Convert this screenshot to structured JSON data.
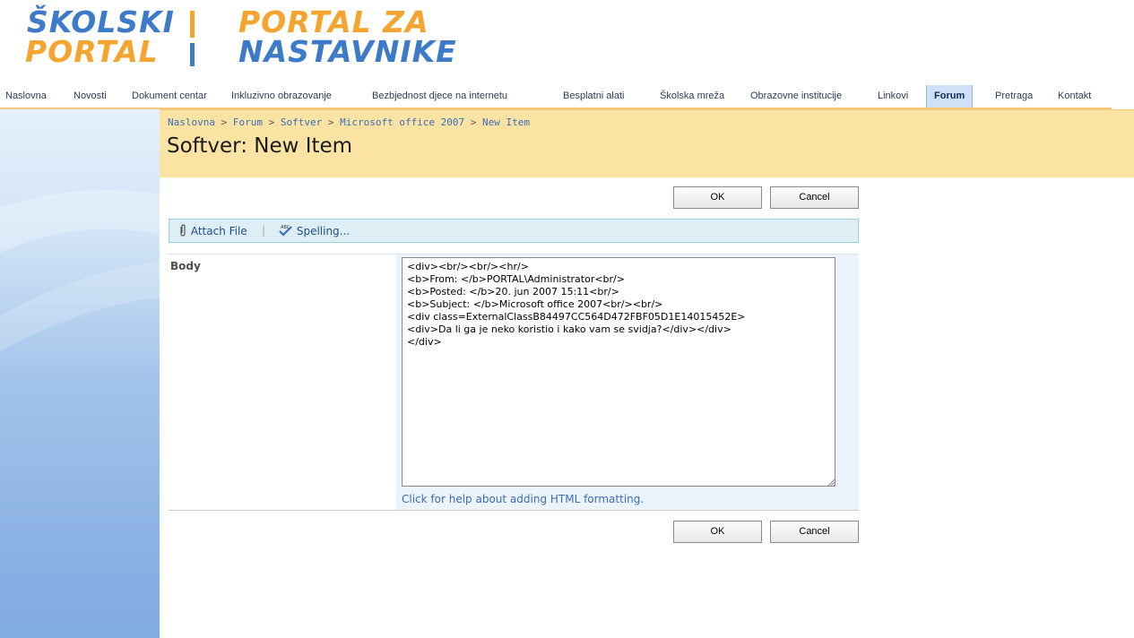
{
  "logo": {
    "left_line1": "ŠKOLSKI",
    "left_line2": "PORTAL",
    "right_line1": "PORTAL ZA",
    "right_line2": "NASTAVNIKE",
    "colors": {
      "blue": "#3d7ac8",
      "orange": "#f5a430"
    }
  },
  "nav": {
    "items": [
      {
        "label": "Naslovna"
      },
      {
        "label": "Novosti"
      },
      {
        "label": "Dokument centar"
      },
      {
        "label": "Inkluzivno obrazovanje"
      },
      {
        "label": "Bezbjednost djece na internetu"
      },
      {
        "label": "Besplatni alati"
      },
      {
        "label": "Školska mreža"
      },
      {
        "label": "Obrazovne institucije"
      },
      {
        "label": "Linkovi"
      },
      {
        "label": "Forum",
        "active": true
      },
      {
        "label": "Pretraga"
      },
      {
        "label": "Kontakt"
      }
    ]
  },
  "breadcrumb": {
    "items": [
      "Naslovna",
      "Forum",
      "Softver",
      "Microsoft office 2007",
      "New Item"
    ],
    "separator": ">"
  },
  "page": {
    "title": "Softver: New Item"
  },
  "buttons": {
    "ok": "OK",
    "cancel": "Cancel"
  },
  "toolbar": {
    "attach": "Attach File",
    "spelling": "Spelling..."
  },
  "form": {
    "body_label": "Body",
    "body_value": "<div><br/><br/><hr/>\n<b>From: </b>PORTAL\\Administrator<br/>\n<b>Posted: </b>20. jun 2007 15:11<br/>\n<b>Subject: </b>Microsoft office 2007<br/><br/>\n<div class=ExternalClassB84497CC564D472FBF05D1E14015452E>\n<div>Da li ga je neko koristio i kako vam se svidja?</div></div>\n</div>",
    "help_link": "Click for help about adding HTML formatting."
  }
}
